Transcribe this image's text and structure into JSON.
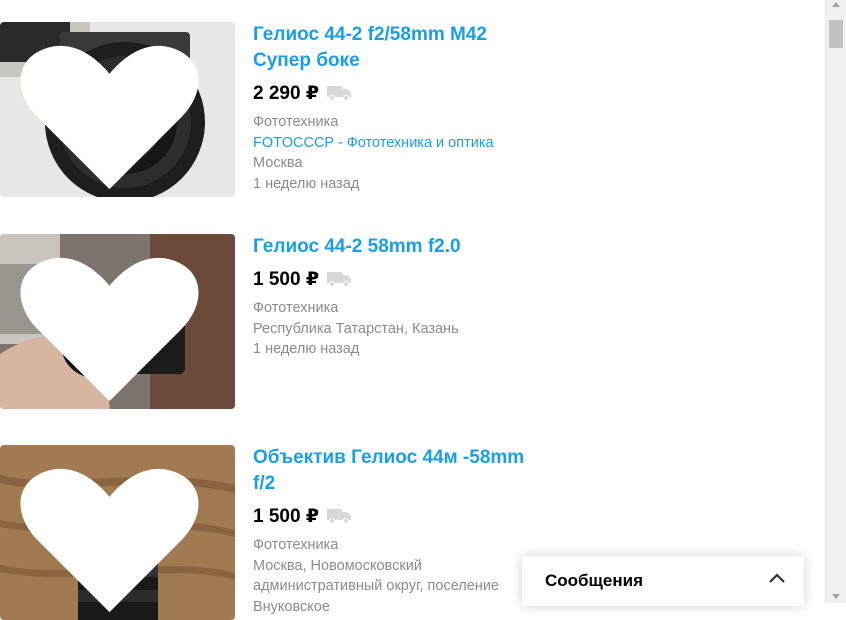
{
  "listings": [
    {
      "title_line1": "Гелиос 44-2 f2/58mm M42",
      "title_line2": "Супер боке",
      "price": "2 290 ₽",
      "category": "Фототехника",
      "seller": "FOTOCCCP - Фототехника и оптика",
      "location": "Москва",
      "time": "1 неделю назад"
    },
    {
      "title_line1": "Гелиос 44-2 58mm f2.0",
      "price": "1 500 ₽",
      "category": "Фототехника",
      "location": "Республика Татарстан, Казань",
      "time": "1 неделю назад"
    },
    {
      "title_line1": "Объектив Гелиос 44м -58mm",
      "title_line2": "f/2",
      "price": "1 500 ₽",
      "category": "Фототехника",
      "location_line1": "Москва, Новомосковский",
      "location_line2": "административный округ, поселение",
      "location_line3": "Внуковское"
    }
  ],
  "messages_panel": {
    "label": "Сообщения"
  },
  "colors": {
    "link": "#1a9ee6",
    "meta": "#8c8c8c",
    "favorite": "#ffffff",
    "delivery_icon": "#d8d8d8"
  }
}
